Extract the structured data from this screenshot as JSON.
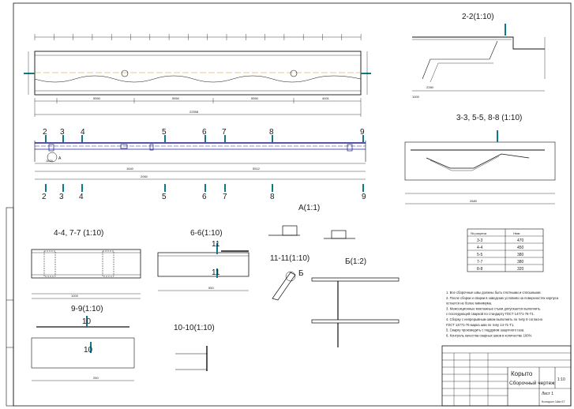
{
  "sections": {
    "s22": "2-2(1:10)",
    "s33": "3-3, 5-5, 8-8 (1:10)",
    "s44": "4-4, 7-7 (1:10)",
    "s66": "6-6(1:10)",
    "s99": "9-9(1:10)",
    "s1010": "10-10(1:10)",
    "s1111": "11-11(1:10)",
    "detA": "A(1:1)",
    "detB": "Б(1:2)",
    "lblA": "А",
    "lblB": "Б"
  },
  "callouts": {
    "c2": "2",
    "c3": "3",
    "c4": "4",
    "c5": "5",
    "c6": "6",
    "c7": "7",
    "c8": "8",
    "c9": "9",
    "c10": "10",
    "c11": "11"
  },
  "dims": {
    "d5550a": "5550",
    "d5550b": "5550",
    "d5550c": "5550",
    "d4001": "4001",
    "d2258": "22558",
    "d1600": "1600",
    "d1640": "1640",
    "d5512": "5512",
    "d2060": "2060",
    "d2680": "2680",
    "d2280": "2280",
    "d1000": "1000",
    "d550": "550",
    "d250": "250"
  },
  "table": {
    "header": [
      "№ разреза",
      "Нмм"
    ],
    "rows": [
      [
        "3-3",
        "470"
      ],
      [
        "4-4",
        "450"
      ],
      [
        "5-5",
        "380"
      ],
      [
        "7-7",
        "380"
      ],
      [
        "8-8",
        "320"
      ]
    ]
  },
  "notes": [
    "1. Все сборочные швы должны быть плотными и сплошными.",
    "2. После сборки и сварки в заводских условиях на поверхностях корпуса",
    "    остается не более минимума.",
    "3. Межсекционные монтажные стыки допускается выполнять",
    "    с последующей сваркой по стандарту ГОСТ 14771-76-Т1.",
    "4. Сборку с непрерывным швом выполнить по типу 6 согласно",
    "    ГОСТ 14771-76 марка шва по типу 14-71-Т1.",
    "5. Сварку производить с поддувом защитного газа.",
    "6. Контроль качества сварных швов в количестве 100%"
  ],
  "titleblock": {
    "title1": "Корыто",
    "title2": "Сборочный чертеж",
    "scale": "1:10",
    "sheet": "Лист 1",
    "sheets": "Листов 1",
    "sub": "Колорон 14м 07"
  }
}
